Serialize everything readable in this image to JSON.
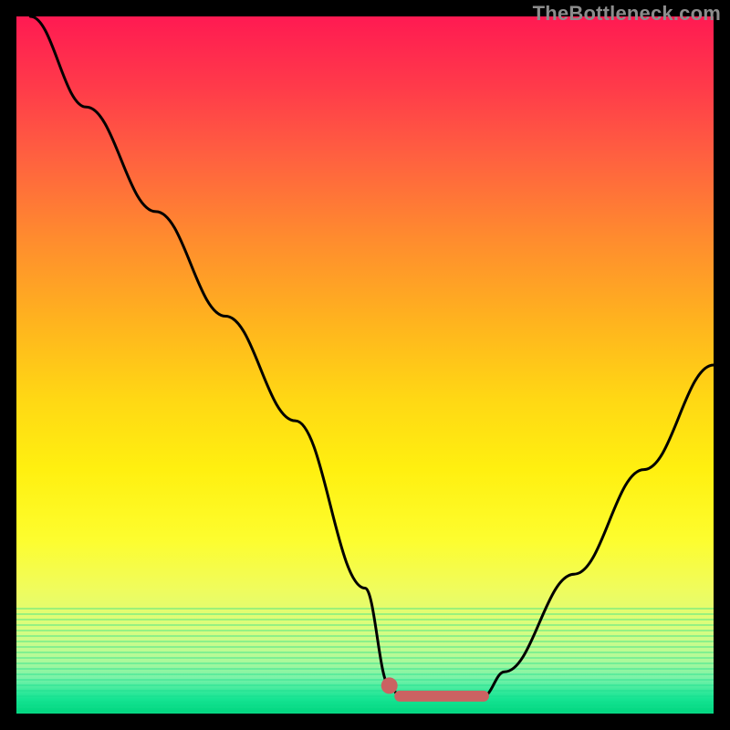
{
  "watermark": "TheBottleneck.com",
  "chart_data": {
    "type": "line",
    "title": "",
    "xlabel": "",
    "ylabel": "",
    "xlim": [
      0,
      100
    ],
    "ylim": [
      0,
      100
    ],
    "x": [
      2,
      10,
      20,
      30,
      40,
      50,
      53.5,
      55,
      58,
      62,
      66,
      67,
      70,
      80,
      90,
      100
    ],
    "values": [
      100,
      87,
      72,
      57,
      42,
      18,
      4,
      2.5,
      2,
      2,
      2.3,
      2.5,
      6,
      20,
      35,
      50
    ],
    "annotations": [
      {
        "kind": "marker_dot",
        "x": 53.5,
        "y": 4
      },
      {
        "kind": "flat_segment",
        "x0": 55,
        "x1": 67,
        "y": 2.5
      }
    ],
    "colors": {
      "curve": "#000000",
      "marker": "#cb6262",
      "gradient_top": "#ff1a52",
      "gradient_bottom": "#00d47e"
    }
  }
}
